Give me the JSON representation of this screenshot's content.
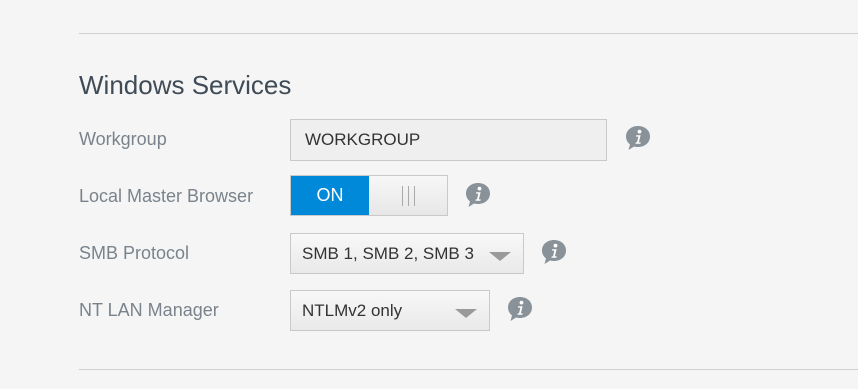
{
  "section": {
    "title": "Windows Services"
  },
  "workgroup": {
    "label": "Workgroup",
    "value": "WORKGROUP",
    "info_icon": "info-icon"
  },
  "local_master_browser": {
    "label": "Local Master Browser",
    "on_label": "ON",
    "state": "on",
    "info_icon": "info-icon"
  },
  "smb_protocol": {
    "label": "SMB Protocol",
    "selected": "SMB 1, SMB 2, SMB 3",
    "info_icon": "info-icon"
  },
  "nt_lan_manager": {
    "label": "NT LAN Manager",
    "selected": "NTLMv2 only",
    "info_icon": "info-icon"
  },
  "colors": {
    "accent": "#0088d9",
    "label_text": "#7a838b",
    "title_text": "#3f4b56",
    "icon": "#8a9299"
  }
}
